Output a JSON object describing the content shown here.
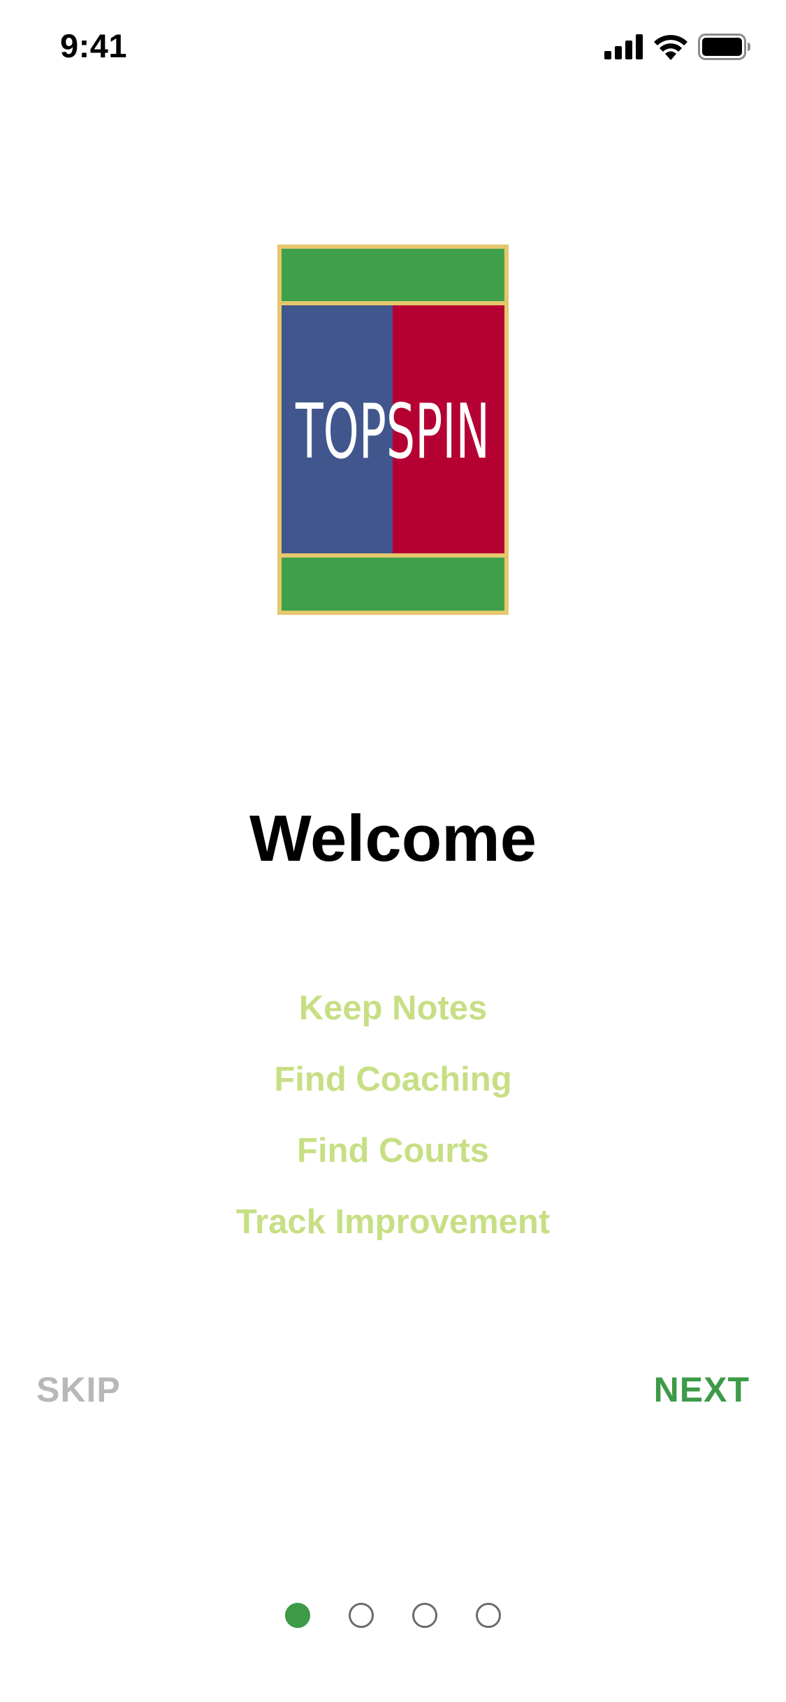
{
  "status_bar": {
    "time": "9:41",
    "icons": [
      "cellular-signal-icon",
      "wifi-icon",
      "battery-icon"
    ]
  },
  "logo": {
    "text": "TOPSPIN",
    "colors": {
      "green": "#40a04a",
      "blue": "#41568d",
      "red": "#b50033",
      "border": "#e6c76e",
      "text": "#ffffff"
    }
  },
  "welcome": {
    "title": "Welcome"
  },
  "features": [
    "Keep Notes",
    "Find Coaching",
    "Find Courts",
    "Track Improvement"
  ],
  "actions": {
    "skip_label": "SKIP",
    "next_label": "NEXT"
  },
  "pagination": {
    "total": 4,
    "current": 1
  },
  "colors": {
    "accent": "#3d9a47",
    "feature_text": "#c7df84",
    "skip_text": "#b8b8b8"
  }
}
